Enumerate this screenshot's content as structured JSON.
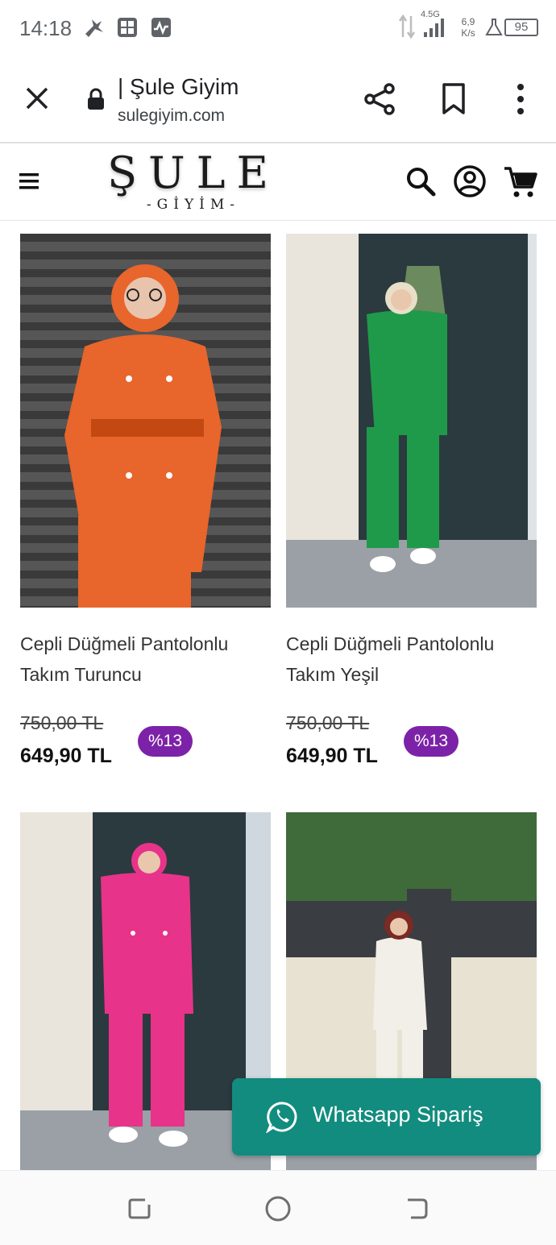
{
  "status_bar": {
    "time": "14:18",
    "network": "4.5G",
    "speed": "6,9 K/s",
    "battery": "95"
  },
  "browser": {
    "page_title": "| Şule Giyim",
    "domain": "sulegiyim.com"
  },
  "site": {
    "logo_main": "ŞULE",
    "logo_sub": "-GİYİM-"
  },
  "products": [
    {
      "name": "Cepli Düğmeli Pantolonlu Takım Turuncu",
      "old_price": "750,00 TL",
      "price": "649,90 TL",
      "discount": "%13",
      "color": "#e8652c"
    },
    {
      "name": "Cepli Düğmeli Pantolonlu Takım Yeşil",
      "old_price": "750,00 TL",
      "price": "649,90 TL",
      "discount": "%13",
      "color": "#1f9a4a"
    },
    {
      "color": "#e8338a"
    },
    {
      "color": "#f1efe8"
    }
  ],
  "whatsapp": {
    "label": "Whatsapp Sipariş"
  },
  "colors": {
    "badge": "#7c22a8",
    "whatsapp": "#128c7e"
  }
}
